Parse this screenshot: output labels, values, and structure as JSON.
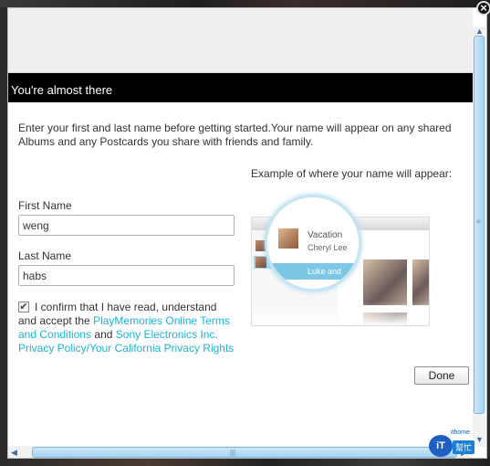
{
  "header": {
    "title": "You're almost there"
  },
  "intro": {
    "text": "Enter your first and last name before getting started.Your name will appear on any shared Albums and any Postcards you share with friends and family."
  },
  "example": {
    "caption": "Example of where your name will appear:",
    "album_title": "Vacation",
    "owner_name": "Cheryl Lee",
    "selected_item": "Luke and"
  },
  "form": {
    "first_name_label": "First Name",
    "first_name_value": "weng",
    "last_name_label": "Last Name",
    "last_name_value": "habs"
  },
  "confirm": {
    "checked": true,
    "check_glyph": "✔",
    "text_1": "I confirm that I have read, understand and accept the ",
    "link_terms": "PlayMemories Online Terms and Conditions",
    "text_2": " and ",
    "link_privacy": "Sony Electronics Inc. Privacy Policy/Your California Privacy Rights"
  },
  "buttons": {
    "done": "Done",
    "close": "×"
  },
  "scrollbar": {
    "up": "▲",
    "down": "▼",
    "left": "◀",
    "right": "▶",
    "grip_v": "≡",
    "grip_h": "|||"
  },
  "watermark": {
    "logo": "iT",
    "tag": "幫忙",
    "url": "ithome"
  },
  "icons": {
    "close": "close-icon",
    "check": "check-icon"
  },
  "colors": {
    "header_bg": "#000000",
    "link": "#1ab4d6",
    "accent": "#a8d4f2"
  }
}
